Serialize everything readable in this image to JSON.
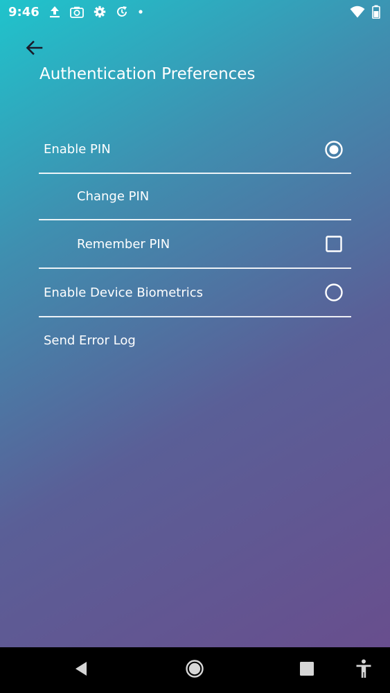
{
  "status_bar": {
    "time": "9:46",
    "icons_left": [
      "upload-icon",
      "camera-icon",
      "gear-icon",
      "sync-icon",
      "dot-icon"
    ],
    "icons_right": [
      "wifi-icon",
      "battery-icon"
    ]
  },
  "header": {
    "back_icon": "arrow-left-icon",
    "title": "Authentication Preferences"
  },
  "settings": {
    "items": [
      {
        "label": "Enable PIN",
        "control": "radio",
        "checked": true
      },
      {
        "label": "Change PIN",
        "control": "none"
      },
      {
        "label": "Remember PIN",
        "control": "checkbox",
        "checked": false
      },
      {
        "label": "Enable Device Biometrics",
        "control": "radio",
        "checked": false
      },
      {
        "label": "Send Error Log",
        "control": "none"
      }
    ]
  },
  "nav_bar": {
    "icons": [
      "back-triangle-icon",
      "home-circle-icon",
      "recents-square-icon",
      "accessibility-icon"
    ]
  }
}
